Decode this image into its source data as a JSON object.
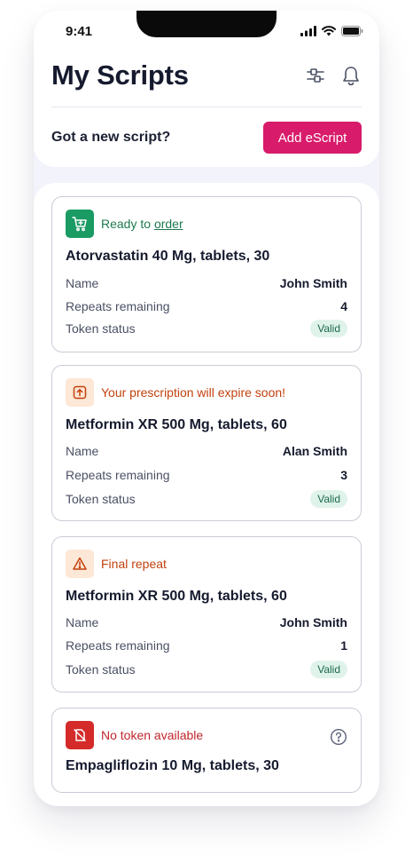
{
  "status_bar": {
    "time": "9:41"
  },
  "header": {
    "title": "My Scripts",
    "prompt": "Got a new script?",
    "add_button": "Add eScript"
  },
  "labels": {
    "name": "Name",
    "repeats": "Repeats remaining",
    "token": "Token status"
  },
  "cards": [
    {
      "status_prefix": "Ready to ",
      "status_link": "order",
      "status_icon": "cart-icon",
      "status_color": "#1d7a4f",
      "icon_bg": "#1a9b63",
      "drug": "Atorvastatin 40 Mg, tablets, 30",
      "name": "John Smith",
      "repeats": "4",
      "token": "Valid"
    },
    {
      "status_text": "Your prescription will expire soon!",
      "status_icon": "expire-icon",
      "status_color": "#c2410c",
      "icon_bg": "#fde7d6",
      "drug": "Metformin XR 500 Mg, tablets, 60",
      "name": "Alan Smith",
      "repeats": "3",
      "token": "Valid"
    },
    {
      "status_text": "Final repeat",
      "status_icon": "warning-icon",
      "status_color": "#c2410c",
      "icon_bg": "#fde7d6",
      "drug": "Metformin XR 500 Mg, tablets, 60",
      "name": "John Smith",
      "repeats": "1",
      "token": "Valid"
    },
    {
      "status_text": "No token available",
      "status_icon": "no-token-icon",
      "status_color": "#c0262d",
      "icon_bg": "#d42a2a",
      "drug": "Empagliflozin 10 Mg, tablets, 30",
      "help_icon": "help-icon"
    }
  ]
}
